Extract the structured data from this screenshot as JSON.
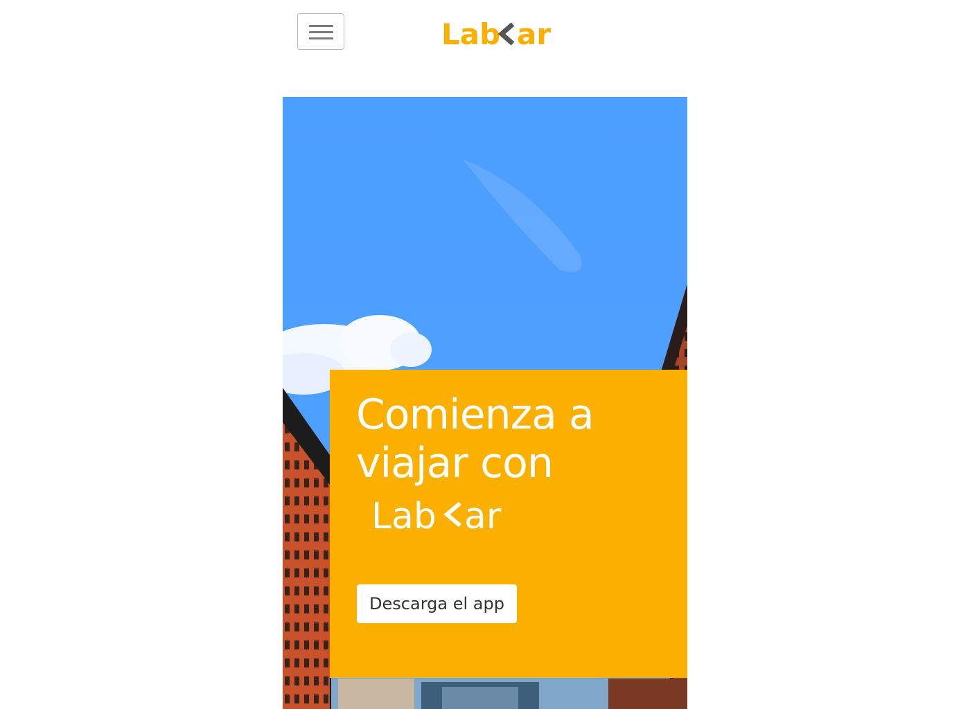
{
  "header": {
    "menu_icon": "hamburger-icon",
    "logo_text": "Lab<ar"
  },
  "hero": {
    "title": "Comienza a viajar con",
    "logo_text": "Lab<ar",
    "cta_label": "Descarga el app"
  },
  "colors": {
    "brand_yellow": "#fbb000",
    "chevron_gray": "#555555",
    "sky_blue": "#4a9cff"
  }
}
